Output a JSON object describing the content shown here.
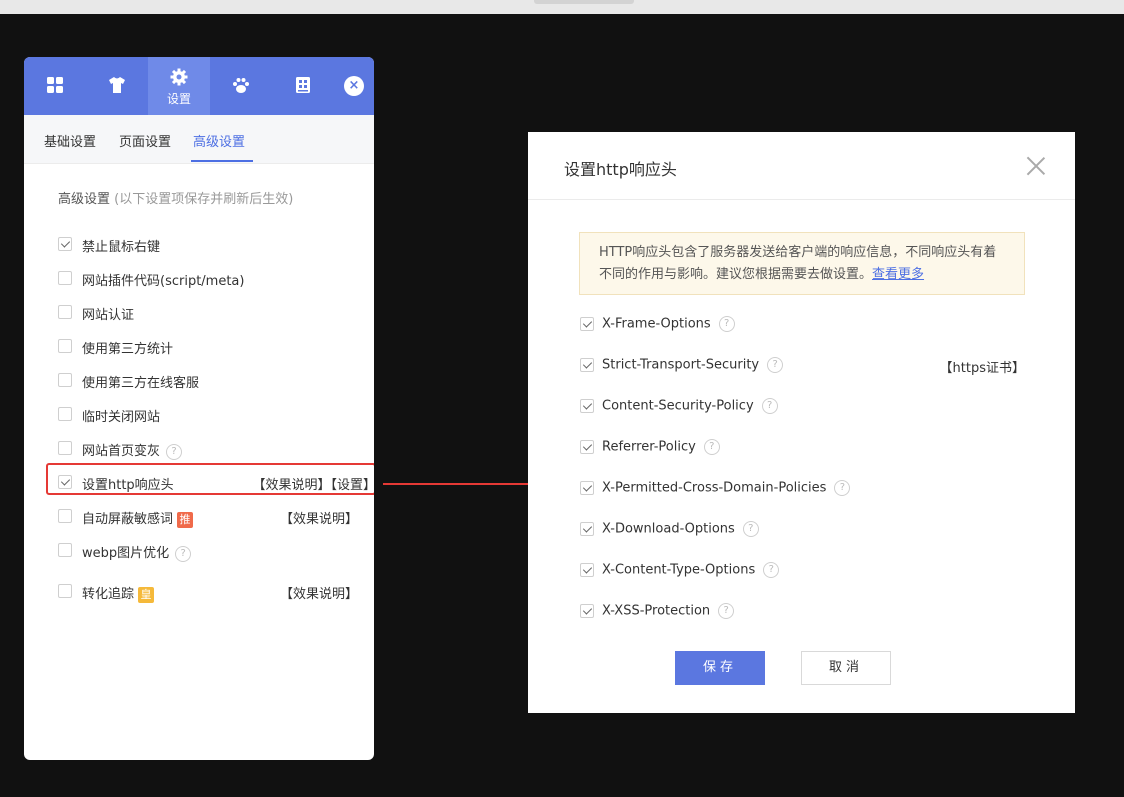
{
  "panel": {
    "tabs": [
      {
        "icon": "grid-icon",
        "label": ""
      },
      {
        "icon": "shirt-icon",
        "label": ""
      },
      {
        "icon": "gear-icon",
        "label": "设置"
      },
      {
        "icon": "paw-icon",
        "label": ""
      },
      {
        "icon": "document-icon",
        "label": ""
      }
    ],
    "active_tab": 2,
    "close_label": "×",
    "subnav": [
      "基础设置",
      "页面设置",
      "高级设置"
    ],
    "active_subnav": 2,
    "section_title": "高级设置",
    "section_note": "(以下设置项保存并刷新后生效)",
    "options": [
      {
        "label": "禁止鼠标右键",
        "checked": true
      },
      {
        "label": "网站插件代码(script/meta)",
        "checked": false
      },
      {
        "label": "网站认证",
        "checked": false
      },
      {
        "label": "使用第三方统计",
        "checked": false
      },
      {
        "label": "使用第三方在线客服",
        "checked": false
      },
      {
        "label": "临时关闭网站",
        "checked": false
      },
      {
        "label": "网站首页变灰",
        "checked": false,
        "help": "?"
      },
      {
        "label": "设置http响应头",
        "checked": true,
        "right": "【效果说明】【设置】"
      },
      {
        "label": "自动屏蔽敏感词",
        "checked": false,
        "badge": "推",
        "right": "【效果说明】"
      },
      {
        "label": "webp图片优化",
        "checked": false,
        "help": "?"
      },
      {
        "label": "转化追踪",
        "checked": false,
        "badge": "皇",
        "right": "【效果说明】"
      }
    ]
  },
  "dialog": {
    "title": "设置http响应头",
    "notice_text": "HTTP响应头包含了服务器发送给客户端的响应信息，不同响应头有着不同的作用与影响。建议您根据需要去做设置。",
    "notice_link": "查看更多",
    "headers": [
      {
        "label": "X-Frame-Options",
        "checked": true,
        "help": "?"
      },
      {
        "label": "Strict-Transport-Security",
        "checked": true,
        "help": "?",
        "right": "【https证书】"
      },
      {
        "label": "Content-Security-Policy",
        "checked": true,
        "help": "?"
      },
      {
        "label": "Referrer-Policy",
        "checked": true,
        "help": "?"
      },
      {
        "label": "X-Permitted-Cross-Domain-Policies",
        "checked": true,
        "help": "?"
      },
      {
        "label": "X-Download-Options",
        "checked": true,
        "help": "?"
      },
      {
        "label": "X-Content-Type-Options",
        "checked": true,
        "help": "?"
      },
      {
        "label": "X-XSS-Protection",
        "checked": true,
        "help": "?"
      }
    ],
    "save_label": "保存",
    "cancel_label": "取消"
  },
  "colors": {
    "accent": "#5b77e0",
    "highlight": "#e53935",
    "notice_bg": "#fdf8ea"
  }
}
